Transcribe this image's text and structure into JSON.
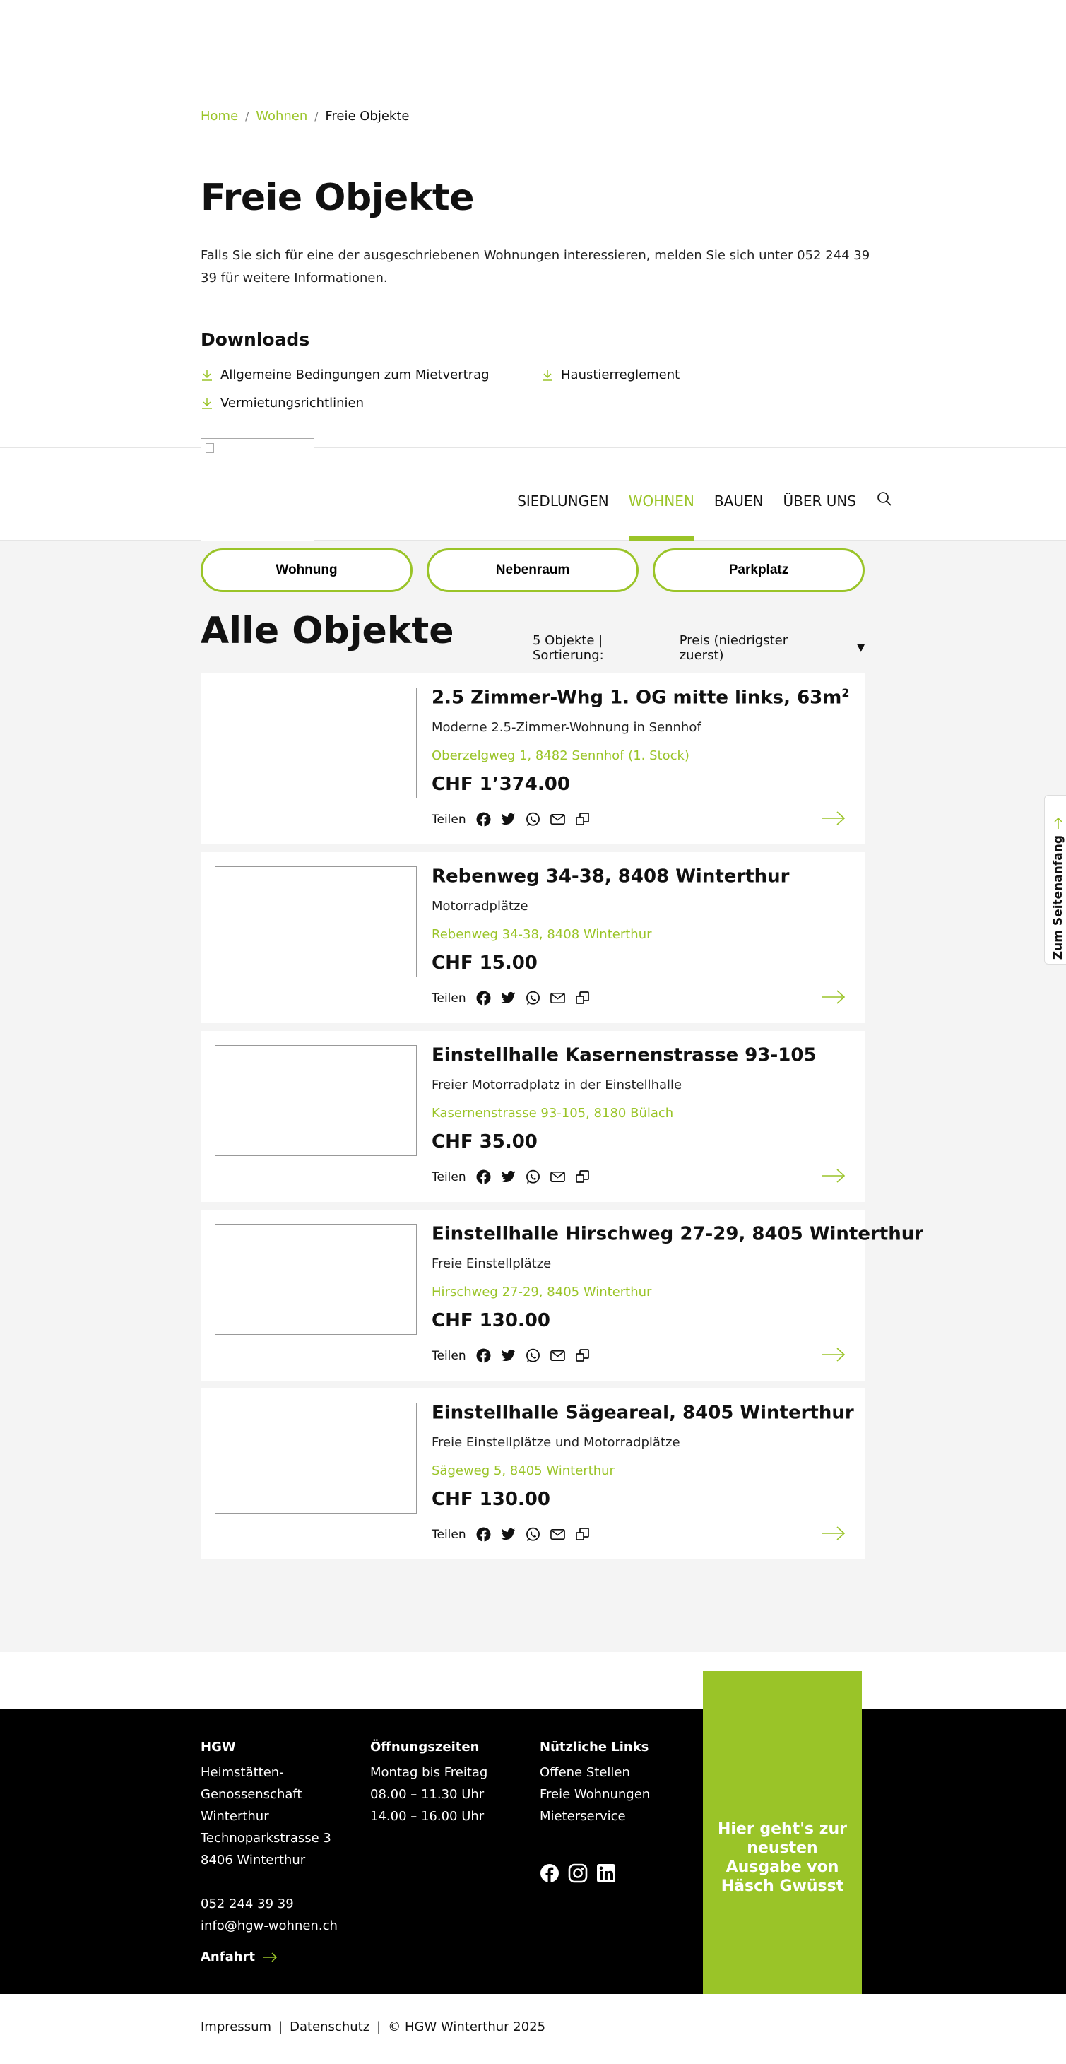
{
  "breadcrumb": {
    "home": "Home",
    "wohnen": "Wohnen",
    "current": "Freie Objekte"
  },
  "page": {
    "title": "Freie Objekte",
    "intro": "Falls Sie sich für eine der ausgeschriebenen Wohnungen interessieren, melden Sie sich unter 052 244 39 39 für weitere Informationen."
  },
  "downloads": {
    "title": "Downloads",
    "items": [
      "Allgemeine Bedingungen zum Mietvertrag",
      "Haustierreglement",
      "Vermietungsrichtlinien"
    ]
  },
  "nav": {
    "items": [
      "SIEDLUNGEN",
      "WOHNEN",
      "BAUEN",
      "ÜBER UNS"
    ],
    "active": "WOHNEN"
  },
  "filters": [
    "Wohnung",
    "Nebenraum",
    "Parkplatz"
  ],
  "listing": {
    "title": "Alle Objekte",
    "count_label": "5 Objekte | Sortierung:",
    "sort_value": "Preis (niedrigster zuerst)",
    "share_label": "Teilen",
    "items": [
      {
        "title": "2.5 Zimmer-Whg 1. OG mitte links, 63m",
        "title_sup": "2",
        "subtitle": "Moderne 2.5-Zimmer-Wohnung in Sennhof",
        "address": "Oberzelgweg 1, 8482 Sennhof (1. Stock)",
        "price": "CHF 1’374.00"
      },
      {
        "title": "Rebenweg 34-38, 8408 Winterthur",
        "title_sup": "",
        "subtitle": "Motorradplätze",
        "address": "Rebenweg 34-38, 8408 Winterthur",
        "price": "CHF 15.00"
      },
      {
        "title": "Einstellhalle Kasernenstrasse 93-105",
        "title_sup": "",
        "subtitle": "Freier Motorradplatz in der Einstellhalle",
        "address": "Kasernenstrasse 93-105, 8180 Bülach",
        "price": "CHF 35.00"
      },
      {
        "title": "Einstellhalle Hirschweg 27-29, 8405 Winterthur",
        "title_sup": "",
        "subtitle": "Freie Einstellplätze",
        "address": "Hirschweg 27-29, 8405 Winterthur",
        "price": "CHF 130.00"
      },
      {
        "title": "Einstellhalle Sägeareal, 8405 Winterthur",
        "title_sup": "",
        "subtitle": "Freie Einstellplätze und Motorradplätze",
        "address": "Sägeweg 5, 8405 Winterthur",
        "price": "CHF 130.00"
      }
    ]
  },
  "to_top": "Zum Seitenanfang",
  "footer": {
    "hgw": {
      "title": "HGW",
      "lines": [
        "Heimstätten-",
        "Genossenschaft",
        "Winterthur",
        "Technoparkstrasse 3",
        "8406 Winterthur"
      ],
      "phone": "052 244 39 39",
      "email": "info@hgw-wohnen.ch",
      "anfahrt": "Anfahrt"
    },
    "hours": {
      "title": "Öffnungszeiten",
      "lines": [
        "Montag bis Freitag",
        "08.00 – 11.30 Uhr",
        "14.00 – 16.00 Uhr"
      ]
    },
    "links": {
      "title": "Nützliche Links",
      "items": [
        "Offene Stellen",
        "Freie Wohnungen",
        "Mieterservice"
      ]
    },
    "promo": "Hier geht's zur neusten Ausgabe von Häsch Gwüsst",
    "social": [
      "facebook-icon",
      "instagram-icon",
      "linkedin-icon"
    ]
  },
  "bottom": {
    "impressum": "Impressum",
    "datenschutz": "Datenschutz",
    "copyright": "© HGW Winterthur 2025"
  },
  "colors": {
    "accent": "#9ac428",
    "footer_bg": "#000000",
    "main_bg": "#f4f4f4"
  }
}
